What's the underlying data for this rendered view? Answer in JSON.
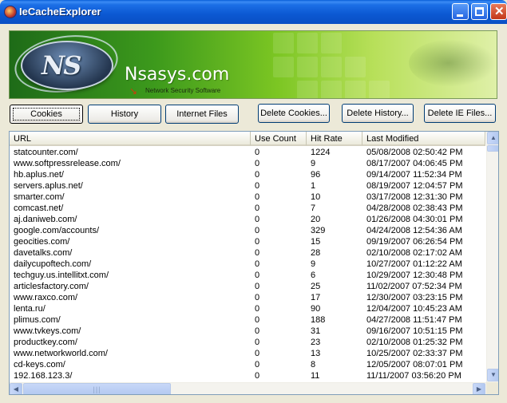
{
  "window": {
    "title": "IeCacheExplorer"
  },
  "banner": {
    "logo_text": "NS",
    "brand": "Nsasys.com",
    "tagline": "Network Security Software"
  },
  "tabs": {
    "cookies": "Cookies",
    "history": "History",
    "internet_files": "Internet Files"
  },
  "actions": {
    "delete_cookies": "Delete Cookies...",
    "delete_history": "Delete History...",
    "delete_ie_files": "Delete IE Files..."
  },
  "list": {
    "columns": {
      "url": "URL",
      "use_count": "Use Count",
      "hit_rate": "Hit Rate",
      "last_modified": "Last Modified"
    },
    "rows": [
      {
        "url": "statcounter.com/",
        "use": "0",
        "hit": "1224",
        "mod": "05/08/2008 02:50:42 PM"
      },
      {
        "url": "www.softpressrelease.com/",
        "use": "0",
        "hit": "9",
        "mod": "08/17/2007 04:06:45 PM"
      },
      {
        "url": "hb.aplus.net/",
        "use": "0",
        "hit": "96",
        "mod": "09/14/2007 11:52:34 PM"
      },
      {
        "url": "servers.aplus.net/",
        "use": "0",
        "hit": "1",
        "mod": "08/19/2007 12:04:57 PM"
      },
      {
        "url": "smarter.com/",
        "use": "0",
        "hit": "10",
        "mod": "03/17/2008 12:31:30 PM"
      },
      {
        "url": "comcast.net/",
        "use": "0",
        "hit": "7",
        "mod": "04/28/2008 02:38:43 PM"
      },
      {
        "url": "aj.daniweb.com/",
        "use": "0",
        "hit": "20",
        "mod": "01/26/2008 04:30:01 PM"
      },
      {
        "url": "google.com/accounts/",
        "use": "0",
        "hit": "329",
        "mod": "04/24/2008 12:54:36 AM"
      },
      {
        "url": "geocities.com/",
        "use": "0",
        "hit": "15",
        "mod": "09/19/2007 06:26:54 PM"
      },
      {
        "url": "davetalks.com/",
        "use": "0",
        "hit": "28",
        "mod": "02/10/2008 02:17:02 AM"
      },
      {
        "url": "dailycupoftech.com/",
        "use": "0",
        "hit": "9",
        "mod": "10/27/2007 01:12:22 AM"
      },
      {
        "url": "techguy.us.intellitxt.com/",
        "use": "0",
        "hit": "6",
        "mod": "10/29/2007 12:30:48 PM"
      },
      {
        "url": "articlesfactory.com/",
        "use": "0",
        "hit": "25",
        "mod": "11/02/2007 07:52:34 PM"
      },
      {
        "url": "www.raxco.com/",
        "use": "0",
        "hit": "17",
        "mod": "12/30/2007 03:23:15 PM"
      },
      {
        "url": "lenta.ru/",
        "use": "0",
        "hit": "90",
        "mod": "12/04/2007 10:45:23 AM"
      },
      {
        "url": "plimus.com/",
        "use": "0",
        "hit": "188",
        "mod": "04/27/2008 11:51:47 PM"
      },
      {
        "url": "www.tvkeys.com/",
        "use": "0",
        "hit": "31",
        "mod": "09/16/2007 10:51:15 PM"
      },
      {
        "url": "productkey.com/",
        "use": "0",
        "hit": "23",
        "mod": "02/10/2008 01:25:32 PM"
      },
      {
        "url": "www.networkworld.com/",
        "use": "0",
        "hit": "13",
        "mod": "10/25/2007 02:33:37 PM"
      },
      {
        "url": "cd-keys.com/",
        "use": "0",
        "hit": "8",
        "mod": "12/05/2007 08:07:01 PM"
      },
      {
        "url": "192.168.123.3/",
        "use": "0",
        "hit": "11",
        "mod": "11/11/2007 03:56:20 PM"
      }
    ]
  },
  "icons": {
    "app": "app-icon",
    "minimize": "minimize-icon",
    "maximize": "maximize-icon",
    "close": "close-icon",
    "scroll_up": "arrow-up-icon",
    "scroll_down": "arrow-down-icon",
    "scroll_left": "arrow-left-icon",
    "scroll_right": "arrow-right-icon"
  },
  "colors": {
    "titlebar": "#0a58d2",
    "banner_green": "#3d9a1c",
    "window_bg": "#ece9d8",
    "list_border": "#7f9db9"
  }
}
